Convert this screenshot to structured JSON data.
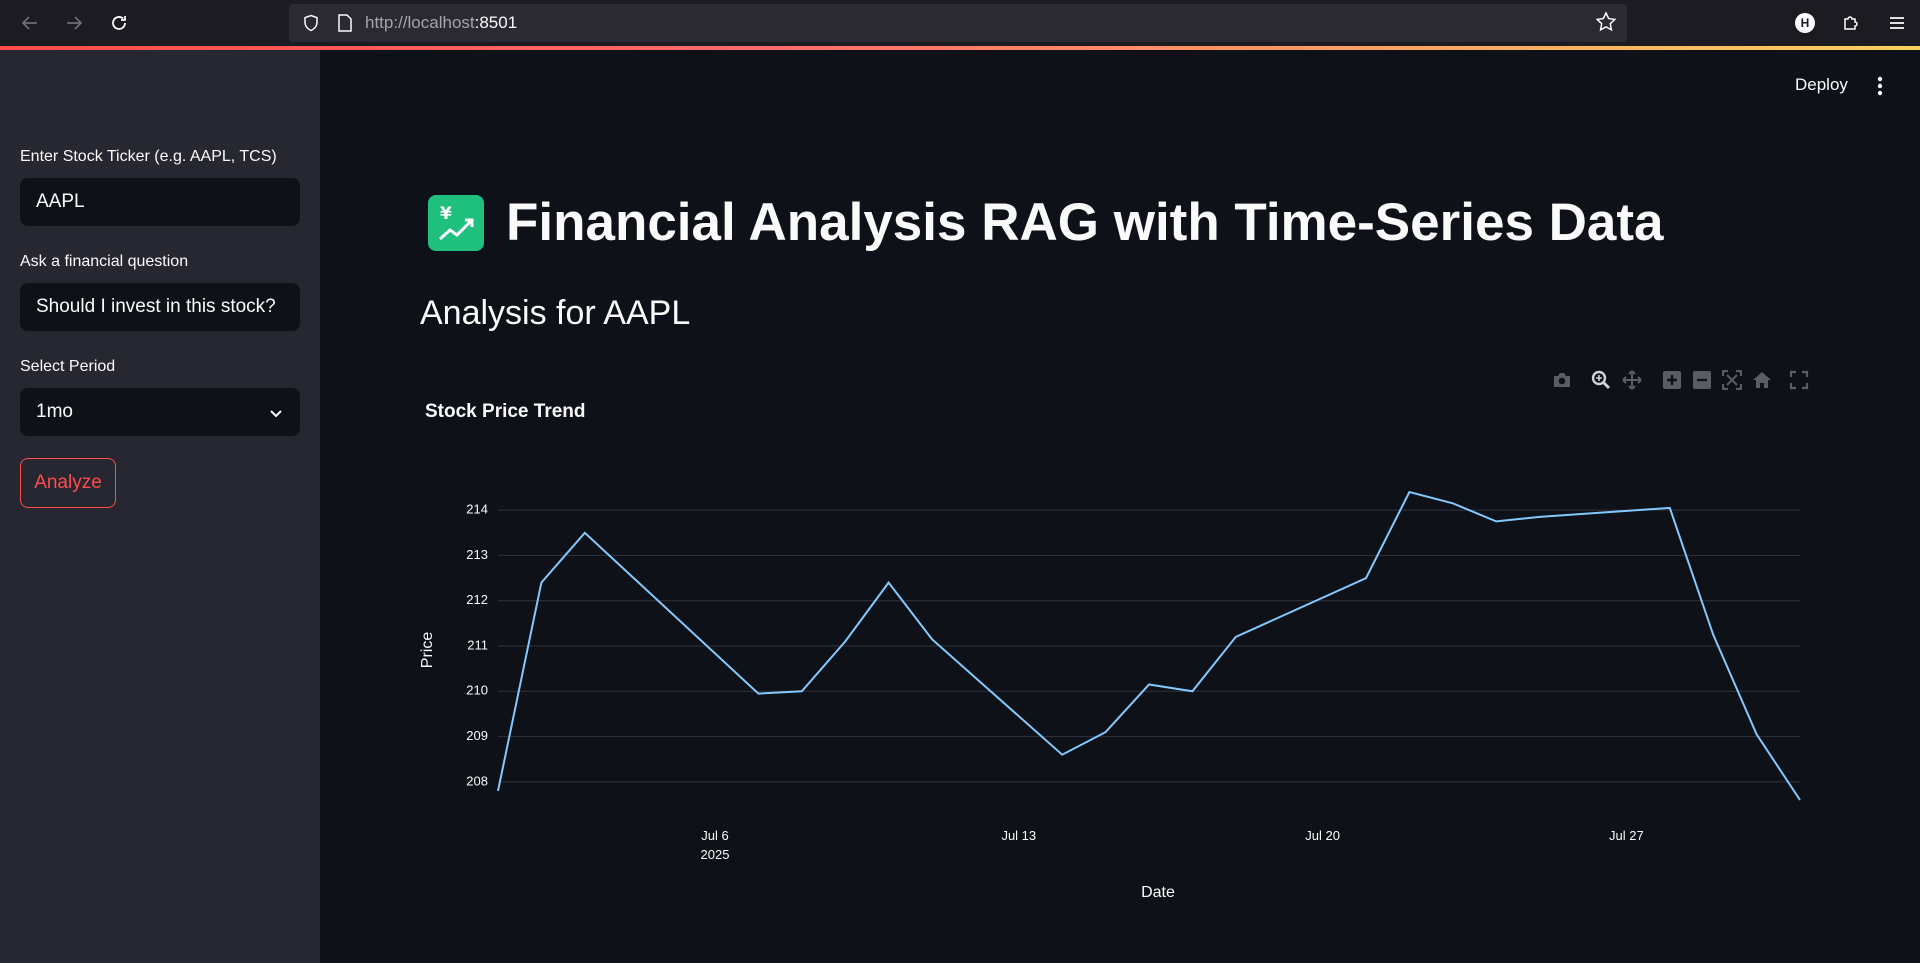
{
  "browser": {
    "url_base": "http://localhost",
    "url_port": ":8501"
  },
  "header": {
    "deploy_label": "Deploy"
  },
  "sidebar": {
    "ticker_label": "Enter Stock Ticker (e.g. AAPL, TCS)",
    "ticker_value": "AAPL",
    "question_label": "Ask a financial question",
    "question_value": "Should I invest in this stock?",
    "period_label": "Select Period",
    "period_value": "1mo",
    "analyze_label": "Analyze"
  },
  "main": {
    "title": "Financial Analysis RAG with Time-Series Data",
    "title_icon": "chart-with-upwards-trend-yen-icon",
    "subtitle": "Analysis for AAPL"
  },
  "modebar": [
    "camera-icon",
    "zoom-icon",
    "pan-icon",
    "zoom-in-icon",
    "zoom-out-icon",
    "autoscale-icon",
    "reset-axes-icon",
    "fullscreen-icon"
  ],
  "chart_data": {
    "type": "line",
    "title": "Stock Price Trend",
    "xlabel": "Date",
    "ylabel": "Price",
    "line_color": "#83c9ff",
    "x": [
      "2025-07-01",
      "2025-07-02",
      "2025-07-03",
      "2025-07-07",
      "2025-07-08",
      "2025-07-09",
      "2025-07-10",
      "2025-07-11",
      "2025-07-14",
      "2025-07-15",
      "2025-07-16",
      "2025-07-17",
      "2025-07-18",
      "2025-07-21",
      "2025-07-22",
      "2025-07-23",
      "2025-07-24",
      "2025-07-25",
      "2025-07-28",
      "2025-07-29",
      "2025-07-30",
      "2025-07-31"
    ],
    "y": [
      207.8,
      212.4,
      213.5,
      209.95,
      210.0,
      211.1,
      212.4,
      211.15,
      208.6,
      209.1,
      210.15,
      210.0,
      211.2,
      212.5,
      214.4,
      214.15,
      213.75,
      213.85,
      214.05,
      211.25,
      209.05,
      207.6
    ],
    "xticks": [
      {
        "date": "2025-07-06",
        "label": "Jul 6",
        "sublabel": "2025"
      },
      {
        "date": "2025-07-13",
        "label": "Jul 13"
      },
      {
        "date": "2025-07-20",
        "label": "Jul 20"
      },
      {
        "date": "2025-07-27",
        "label": "Jul 27"
      }
    ],
    "yticks": [
      208,
      209,
      210,
      211,
      212,
      213,
      214
    ],
    "xlim": [
      "2025-07-01",
      "2025-07-31"
    ],
    "ylim": [
      207.6,
      214.4
    ],
    "grid": true
  }
}
